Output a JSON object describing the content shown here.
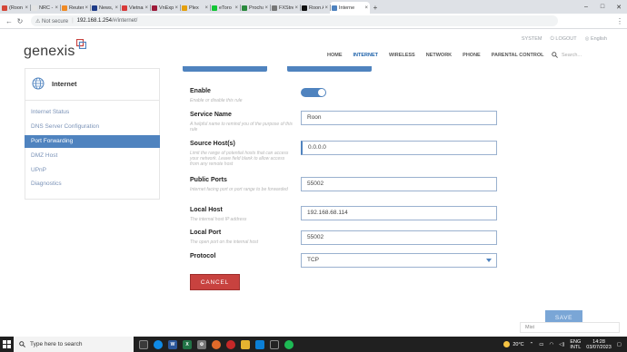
{
  "browser": {
    "tabs": [
      {
        "label": "(Roon L",
        "color": "#d44638"
      },
      {
        "label": "NRC - N",
        "color": "#e4e4e4"
      },
      {
        "label": "Reuters",
        "color": "#f08a24"
      },
      {
        "label": "News, s",
        "color": "#1f3c88"
      },
      {
        "label": "Vietnan",
        "color": "#d83a3a"
      },
      {
        "label": "VnExpre",
        "color": "#9e1a3a"
      },
      {
        "label": "Plex",
        "color": "#e5a00d"
      },
      {
        "label": "eToro",
        "color": "#13c636"
      },
      {
        "label": "Prochat",
        "color": "#2b8a3e"
      },
      {
        "label": "FXStree",
        "color": "#777777"
      },
      {
        "label": "Roon A",
        "color": "#111111"
      },
      {
        "label": "Interne",
        "color": "#4f83bf"
      }
    ],
    "new_tab": "+",
    "security_label": "Not secure",
    "url_host": "192.168.1.254",
    "url_path": "/#/internet/"
  },
  "header": {
    "logo": "genexis",
    "utility": [
      "SYSTEM",
      "LOGOUT",
      "English"
    ],
    "nav": [
      "HOME",
      "INTERNET",
      "WIRELESS",
      "NETWORK",
      "PHONE",
      "PARENTAL CONTROL"
    ],
    "active_nav": "INTERNET",
    "search_placeholder": "Search..."
  },
  "sidebar": {
    "title": "Internet",
    "items": [
      "Internet Status",
      "DNS Server Configuration",
      "Port Forwarding",
      "DMZ Host",
      "UPnP",
      "Diagnostics"
    ],
    "active_item": "Port Forwarding"
  },
  "form": {
    "enable": {
      "label": "Enable",
      "hint": "Enable or disable this rule",
      "on": true
    },
    "service_name": {
      "label": "Service Name",
      "hint": "A helpful name to remind you of the purpose of this rule",
      "value": "Roon"
    },
    "source_hosts": {
      "label": "Source Host(s)",
      "hint": "Limit the range of potential hosts that can access your network. Leave field blank to allow access from any remote host",
      "value": "0.0.0.0"
    },
    "public_ports": {
      "label": "Public Ports",
      "hint": "Internet facing port or port range to be forwarded",
      "value": "55002"
    },
    "local_host": {
      "label": "Local Host",
      "hint": "The internal host IP address",
      "value": "192.168.68.114"
    },
    "local_port": {
      "label": "Local Port",
      "hint": "The open port on the internal host",
      "value": "55002"
    },
    "protocol": {
      "label": "Protocol",
      "value": "TCP"
    },
    "cancel_label": "CANCEL",
    "save_label": "SAVE",
    "toast": "Mist"
  },
  "taskbar": {
    "search_placeholder": "Type here to search",
    "temperature": "20°C",
    "lang_line1": "ENG",
    "lang_line2": "INTL",
    "time": "14:28",
    "date": "03/07/2023"
  }
}
